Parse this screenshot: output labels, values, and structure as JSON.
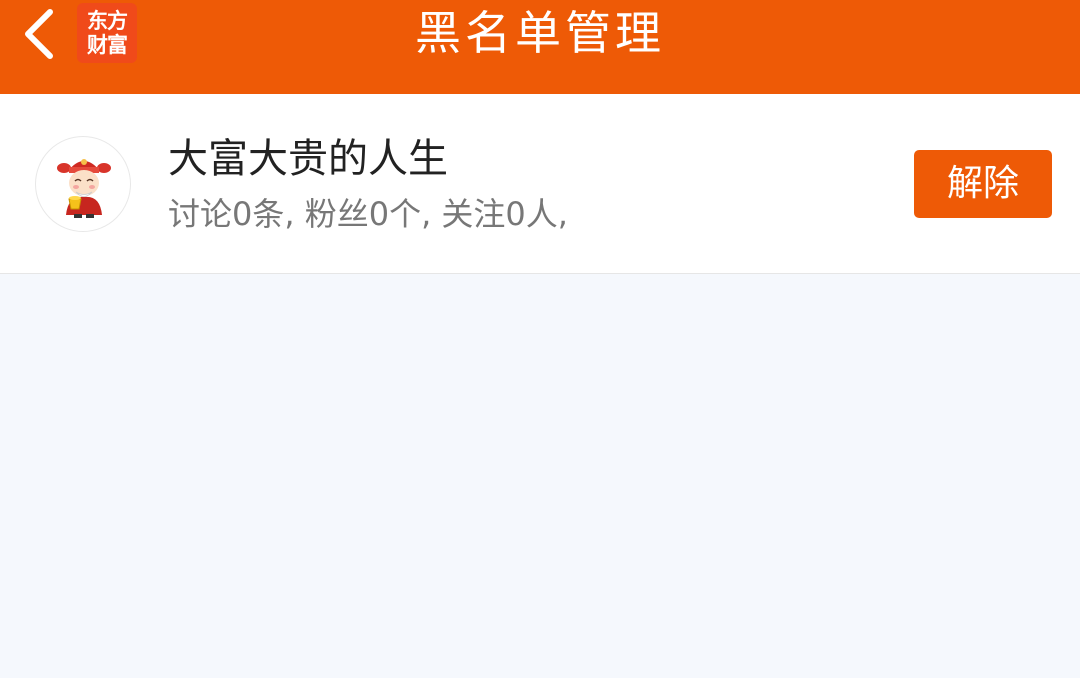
{
  "header": {
    "title": "黑名单管理",
    "logo_line1": "东方",
    "logo_line2": "财富",
    "back_icon": "chevron-left-icon",
    "bg_color": "#ee5a06"
  },
  "blacklist": {
    "items": [
      {
        "name": "大富大贵的人生",
        "stats": "讨论0条, 粉丝0个, 关注0人,",
        "avatar_icon": "god-of-wealth-avatar",
        "action_label": "解除"
      }
    ]
  },
  "colors": {
    "accent": "#ee5a06",
    "background": "#f5f8fd",
    "name_text": "#222222",
    "stats_text": "#777777"
  }
}
